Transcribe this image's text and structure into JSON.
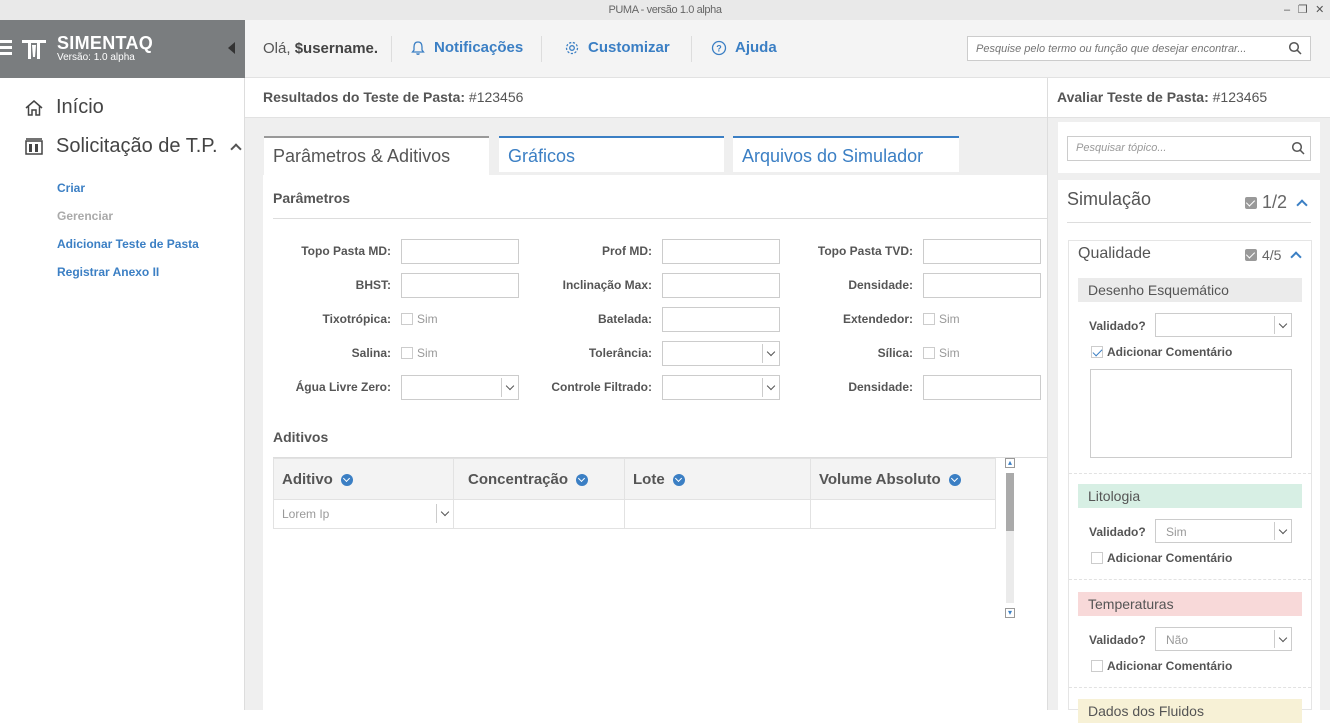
{
  "window": {
    "title": "PUMA - versão 1.0 alpha"
  },
  "brand": {
    "name": "SIMENTAQ",
    "version": "Versão: 1.0 alpha"
  },
  "topbar": {
    "hello_prefix": "Olá,",
    "username": "$username.",
    "notifications": "Notificações",
    "customize": "Customizar",
    "help": "Ajuda",
    "search_placeholder": "Pesquise pelo termo ou função que desejar encontrar..."
  },
  "sidebar": {
    "home": "Início",
    "request": "Solicitação de T.P.",
    "sub": [
      "Criar",
      "Gerenciar",
      "Adicionar Teste de Pasta",
      "Registrar Anexo II"
    ]
  },
  "main": {
    "title_label": "Resultados do Teste de Pasta:",
    "title_id": "#123456",
    "tabs": [
      "Parâmetros & Aditivos",
      "Gráficos",
      "Arquivos do Simulador"
    ],
    "params_title": "Parâmetros",
    "additives_title": "Aditivos",
    "fields": {
      "topo_md": "Topo Pasta MD:",
      "prof_md": "Prof MD:",
      "topo_tvd": "Topo Pasta TVD:",
      "bhst": "BHST:",
      "inclinacao": "Inclinação Max:",
      "densidade1": "Densidade:",
      "tixotropica": "Tixotrópica:",
      "batelada": "Batelada:",
      "extendedor": "Extendedor:",
      "salina": "Salina:",
      "tolerancia": "Tolerância:",
      "silica": "Sílica:",
      "agua_livre": "Água Livre Zero:",
      "controle_filtrado": "Controle Filtrado:",
      "densidade2": "Densidade:",
      "sim": "Sim"
    },
    "grid": {
      "columns": [
        "Aditivo",
        "Concentração",
        "Lote",
        "Volume Absoluto"
      ],
      "row": [
        "Lorem Ip",
        "",
        "",
        ""
      ]
    }
  },
  "right": {
    "title_label": "Avaliar Teste de Pasta:",
    "title_id": "#123465",
    "search_placeholder": "Pesquisar tópico...",
    "sim_title": "Simulação",
    "sim_count": "1/2",
    "qual_title": "Qualidade",
    "qual_count": "4/5",
    "sections": [
      {
        "title": "Desenho Esquemático",
        "validated_label": "Validado?",
        "validated_value": "",
        "comment_label": "Adicionar Comentário",
        "comment_checked": true,
        "color": "#ebebeb"
      },
      {
        "title": "Litologia",
        "validated_label": "Validado?",
        "validated_value": "Sim",
        "comment_label": "Adicionar Comentário",
        "comment_checked": false,
        "color": "#d7efe4"
      },
      {
        "title": "Temperaturas",
        "validated_label": "Validado?",
        "validated_value": "Não",
        "comment_label": "Adicionar Comentário",
        "comment_checked": false,
        "color": "#f8d9d9"
      },
      {
        "title": "Dados dos Fluidos",
        "color": "#f7f1d6"
      }
    ]
  },
  "colors": {
    "accent": "#3b7fc4",
    "brand_bg": "#7a7d7f"
  }
}
